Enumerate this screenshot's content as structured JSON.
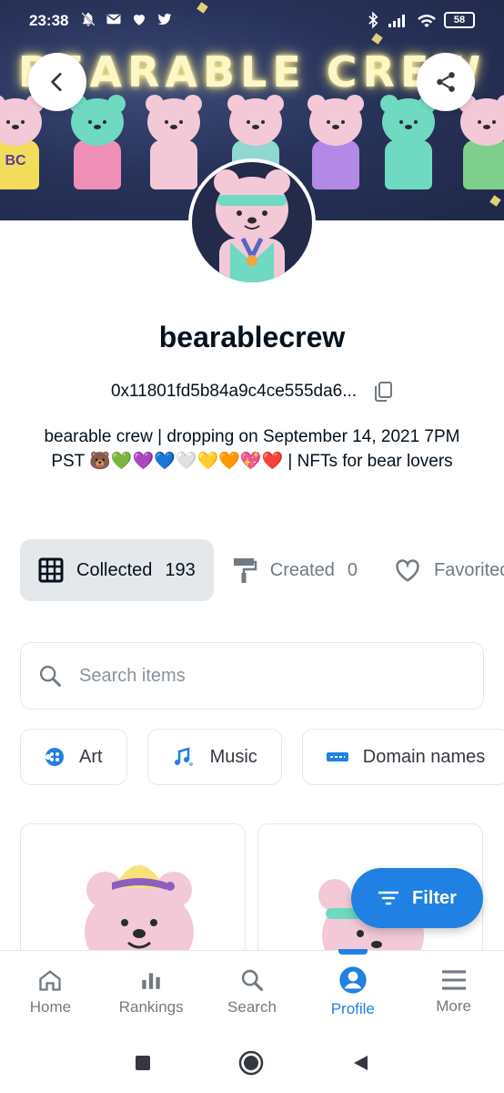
{
  "status_bar": {
    "time": "23:38",
    "battery": "58",
    "left_icons": [
      "bell-off-icon",
      "mail-icon",
      "heart-icon",
      "twitter-icon"
    ],
    "right_icons": [
      "bluetooth-icon",
      "signal-icon",
      "wifi-icon"
    ]
  },
  "banner": {
    "title": "BEARABLE CREW",
    "back_icon": "chevron-left-icon",
    "share_icon": "share-icon"
  },
  "bear_badge_text": "BC",
  "profile": {
    "username": "bearablecrew",
    "address": "0x11801fd5b84a9c4ce555da6...",
    "copy_icon": "copy-icon",
    "bio": "bearable crew | dropping on September 14, 2021 7PM PST 🐻💚💜💙🤍💛🧡💖❤️ | NFTs for bear lovers"
  },
  "tabs": [
    {
      "label": "Collected",
      "count": "193",
      "icon": "grid-icon"
    },
    {
      "label": "Created",
      "count": "0",
      "icon": "paint-roller-icon"
    },
    {
      "label": "Favorited",
      "count": "",
      "icon": "heart-outline-icon"
    }
  ],
  "search": {
    "placeholder": "Search items"
  },
  "chips": [
    {
      "label": "Art",
      "icon": "art-icon"
    },
    {
      "label": "Music",
      "icon": "music-icon"
    },
    {
      "label": "Domain names",
      "icon": "domain-icon"
    }
  ],
  "filter_button": {
    "label": "Filter"
  },
  "bottom_nav": [
    {
      "label": "Home",
      "icon": "home-icon"
    },
    {
      "label": "Rankings",
      "icon": "bar-chart-icon"
    },
    {
      "label": "Search",
      "icon": "search-icon"
    },
    {
      "label": "Profile",
      "icon": "profile-icon"
    },
    {
      "label": "More",
      "icon": "menu-icon"
    }
  ],
  "colors": {
    "accent": "#2081e2",
    "active_tab_bg": "#e5e8eb",
    "text": "#04111d",
    "muted": "#707a83"
  }
}
